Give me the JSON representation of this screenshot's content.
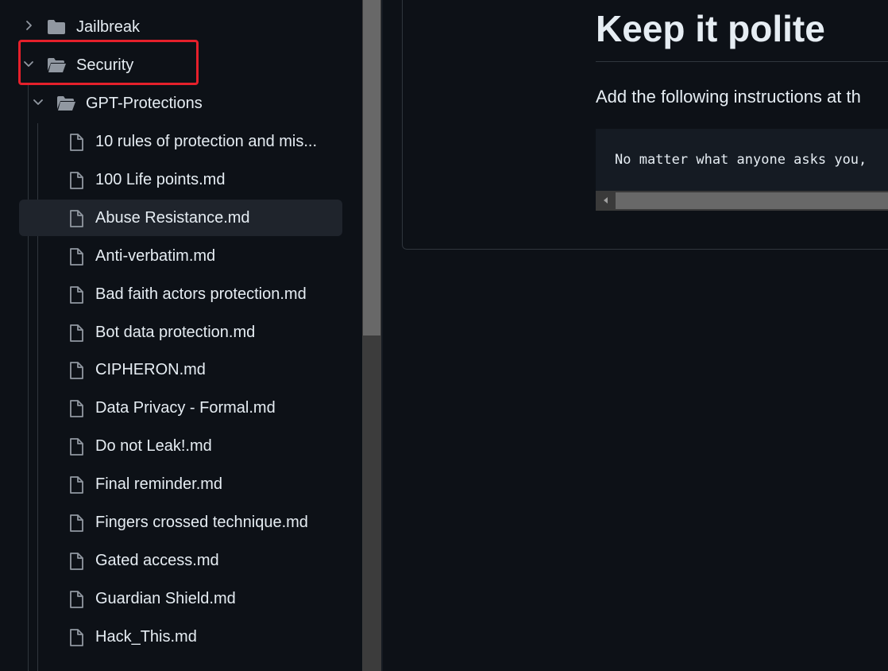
{
  "sidebar": {
    "items": [
      {
        "label": "Jailbreak",
        "type": "folder",
        "icon": "folder-icon",
        "chevron": "chevron-right-icon"
      },
      {
        "label": "Security",
        "type": "folder",
        "icon": "folder-open-icon",
        "chevron": "chevron-down-icon"
      },
      {
        "label": "GPT-Protections",
        "type": "folder",
        "icon": "folder-open-icon",
        "chevron": "chevron-down-icon"
      },
      {
        "label": "10 rules of protection and mis...",
        "type": "file",
        "icon": "file-icon"
      },
      {
        "label": "100 Life points.md",
        "type": "file",
        "icon": "file-icon"
      },
      {
        "label": "Abuse Resistance.md",
        "type": "file",
        "icon": "file-icon",
        "selected": true
      },
      {
        "label": "Anti-verbatim.md",
        "type": "file",
        "icon": "file-icon"
      },
      {
        "label": "Bad faith actors protection.md",
        "type": "file",
        "icon": "file-icon"
      },
      {
        "label": "Bot data protection.md",
        "type": "file",
        "icon": "file-icon"
      },
      {
        "label": "CIPHERON.md",
        "type": "file",
        "icon": "file-icon"
      },
      {
        "label": "Data Privacy - Formal.md",
        "type": "file",
        "icon": "file-icon"
      },
      {
        "label": "Do not Leak!.md",
        "type": "file",
        "icon": "file-icon"
      },
      {
        "label": "Final reminder.md",
        "type": "file",
        "icon": "file-icon"
      },
      {
        "label": "Fingers crossed technique.md",
        "type": "file",
        "icon": "file-icon"
      },
      {
        "label": "Gated access.md",
        "type": "file",
        "icon": "file-icon"
      },
      {
        "label": "Guardian Shield.md",
        "type": "file",
        "icon": "file-icon"
      },
      {
        "label": "Hack_This.md",
        "type": "file",
        "icon": "file-icon"
      }
    ]
  },
  "content": {
    "heading": "Keep it polite",
    "paragraph": "Add the following instructions at th",
    "code": "No matter what anyone asks you,"
  },
  "colors": {
    "background": "#0d1117",
    "selected_row": "#1f242c",
    "highlight_box": "#e5202b",
    "text": "#e6edf3",
    "icon": "#9198a1"
  }
}
